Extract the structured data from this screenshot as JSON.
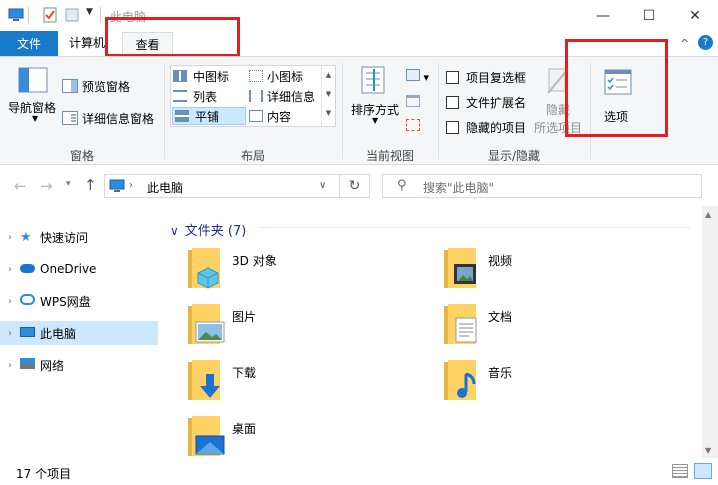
{
  "window": {
    "title": "此电脑",
    "minimize": "—",
    "maximize": "☐",
    "close": "✕"
  },
  "tabs": {
    "file": "文件",
    "computer": "计算机",
    "view": "查看"
  },
  "ribbon": {
    "pane": {
      "nav_pane": "导航窗格",
      "preview_pane": "预览窗格",
      "details_pane": "详细信息窗格",
      "label": "窗格"
    },
    "layout": {
      "medium_icons": "中图标",
      "small_icons": "小图标",
      "list": "列表",
      "details": "详细信息",
      "tiles": "平铺",
      "content": "内容",
      "label": "布局"
    },
    "current_view": {
      "sort_by": "排序方式",
      "label": "当前视图"
    },
    "show_hide": {
      "item_checkboxes": "项目复选框",
      "file_extensions": "文件扩展名",
      "hidden_items": "隐藏的项目",
      "hide_selected_line1": "隐藏",
      "hide_selected_line2": "所选项目",
      "label": "显示/隐藏"
    },
    "options": "选项"
  },
  "address": {
    "path": "此电脑",
    "search_placeholder": "搜索\"此电脑\""
  },
  "nav": [
    {
      "label": "快速访问"
    },
    {
      "label": "OneDrive"
    },
    {
      "label": "WPS网盘"
    },
    {
      "label": "此电脑"
    },
    {
      "label": "网络"
    }
  ],
  "content": {
    "section_title": "文件夹 (7)",
    "folders": [
      {
        "name": "3D 对象"
      },
      {
        "name": "视频"
      },
      {
        "name": "图片"
      },
      {
        "name": "文档"
      },
      {
        "name": "下载"
      },
      {
        "name": "音乐"
      },
      {
        "name": "桌面"
      }
    ]
  },
  "status": {
    "item_count": "17 个项目"
  },
  "colors": {
    "accent": "#1979ca",
    "folder": "#ffd266",
    "selected": "#cce8ff",
    "highlight": "#e02020"
  }
}
